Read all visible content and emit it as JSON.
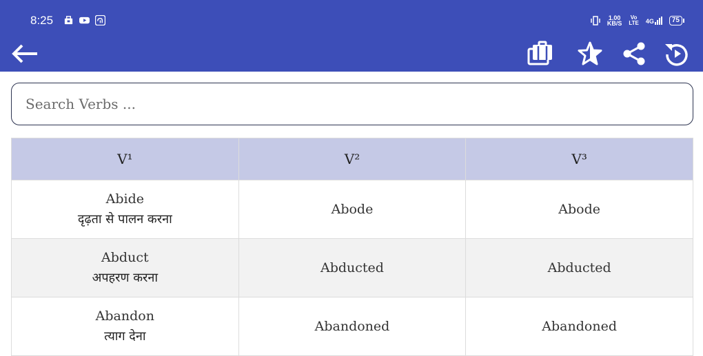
{
  "status": {
    "time": "8:25",
    "net_speed_value": "1.00",
    "net_speed_unit": "KB/S",
    "volte_top": "Vo",
    "volte_bottom": "LTE",
    "network": "4G",
    "battery": "75"
  },
  "colors": {
    "appbar": "#3d4eb8",
    "header_row": "#c5c9e6",
    "alt_row": "#f2f2f2"
  },
  "toolbar": {
    "back_icon": "arrow-left-icon",
    "actions": [
      "briefcase-icon",
      "star-icon",
      "share-icon",
      "refresh-icon"
    ]
  },
  "search": {
    "placeholder": "Search Verbs ..."
  },
  "table": {
    "headers": [
      "V¹",
      "V²",
      "V³"
    ],
    "rows": [
      {
        "v1": "Abide",
        "meaning": "दृढ़ता से पालन करना",
        "v2": "Abode",
        "v3": "Abode"
      },
      {
        "v1": "Abduct",
        "meaning": "अपहरण करना",
        "v2": "Abducted",
        "v3": "Abducted"
      },
      {
        "v1": "Abandon",
        "meaning": "त्याग देना",
        "v2": "Abandoned",
        "v3": "Abandoned"
      }
    ]
  }
}
